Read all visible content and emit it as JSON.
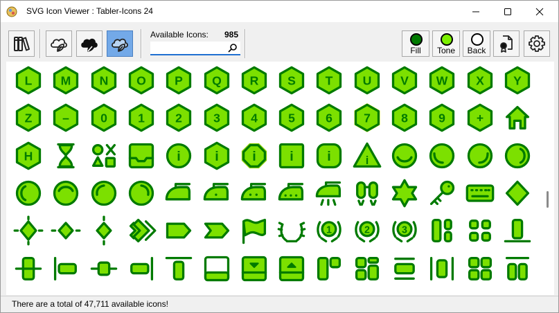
{
  "window": {
    "title": "SVG Icon Viewer : Tabler-Icons 24"
  },
  "toolbar": {
    "available_label": "Available Icons:",
    "available_count": "985",
    "search_value": "",
    "fill_label": "Fill",
    "tone_label": "Tone",
    "back_label": "Back",
    "fill_color": "#007a00",
    "tone_color": "#7cf000",
    "back_color": "#ffffff"
  },
  "colors": {
    "icon_fill": "#7ce000",
    "icon_stroke": "#007a00",
    "active_tab": "#73a9e8"
  },
  "grid": {
    "rows": [
      [
        {
          "shape": "hexagon",
          "label": "L"
        },
        {
          "shape": "hexagon",
          "label": "M"
        },
        {
          "shape": "hexagon",
          "label": "N"
        },
        {
          "shape": "hexagon",
          "label": "O"
        },
        {
          "shape": "hexagon",
          "label": "P"
        },
        {
          "shape": "hexagon",
          "label": "Q"
        },
        {
          "shape": "hexagon",
          "label": "R"
        },
        {
          "shape": "hexagon",
          "label": "S"
        },
        {
          "shape": "hexagon",
          "label": "T"
        },
        {
          "shape": "hexagon",
          "label": "U"
        },
        {
          "shape": "hexagon",
          "label": "V"
        },
        {
          "shape": "hexagon",
          "label": "W"
        },
        {
          "shape": "hexagon",
          "label": "X"
        },
        {
          "shape": "hexagon",
          "label": "Y"
        }
      ],
      [
        {
          "shape": "hexagon",
          "label": "Z"
        },
        {
          "shape": "hexagon",
          "label": "–"
        },
        {
          "shape": "hexagon",
          "label": "0"
        },
        {
          "shape": "hexagon",
          "label": "1"
        },
        {
          "shape": "hexagon",
          "label": "2"
        },
        {
          "shape": "hexagon",
          "label": "3"
        },
        {
          "shape": "hexagon",
          "label": "4"
        },
        {
          "shape": "hexagon",
          "label": "5"
        },
        {
          "shape": "hexagon",
          "label": "6"
        },
        {
          "shape": "hexagon-selected",
          "label": "7"
        },
        {
          "shape": "hexagon",
          "label": "8"
        },
        {
          "shape": "hexagon",
          "label": "9"
        },
        {
          "shape": "hexagon",
          "label": "+"
        },
        {
          "shape": "home",
          "label": ""
        }
      ],
      [
        {
          "shape": "hexagon",
          "label": "H"
        },
        {
          "shape": "hourglass",
          "label": ""
        },
        {
          "shape": "category",
          "label": ""
        },
        {
          "shape": "inbox",
          "label": ""
        },
        {
          "shape": "circle-info",
          "label": "i"
        },
        {
          "shape": "hexagon-info",
          "label": "i"
        },
        {
          "shape": "octagon-info",
          "label": "i"
        },
        {
          "shape": "square-info",
          "label": "i"
        },
        {
          "shape": "rounded-info",
          "label": "i"
        },
        {
          "shape": "triangle-info",
          "label": "i"
        },
        {
          "shape": "circle-arc-bottom",
          "label": ""
        },
        {
          "shape": "circle-arc-left-bottom",
          "label": ""
        },
        {
          "shape": "circle-arc-right-bottom",
          "label": ""
        },
        {
          "shape": "circle-arc-right",
          "label": ""
        }
      ],
      [
        {
          "shape": "circle-arc-left",
          "label": ""
        },
        {
          "shape": "circle-arc-top",
          "label": ""
        },
        {
          "shape": "circle-arc-top-left",
          "label": ""
        },
        {
          "shape": "circle-arc-top-right",
          "label": ""
        },
        {
          "shape": "iron",
          "label": ""
        },
        {
          "shape": "iron-1",
          "label": ""
        },
        {
          "shape": "iron-2",
          "label": ""
        },
        {
          "shape": "iron-3",
          "label": ""
        },
        {
          "shape": "iron-steam",
          "label": ""
        },
        {
          "shape": "jetpack",
          "label": ""
        },
        {
          "shape": "jewish-star",
          "label": ""
        },
        {
          "shape": "key",
          "label": ""
        },
        {
          "shape": "keyboard",
          "label": ""
        },
        {
          "shape": "diamond",
          "label": ""
        }
      ],
      [
        {
          "shape": "diamond-line-both",
          "label": ""
        },
        {
          "shape": "diamond-line-h",
          "label": ""
        },
        {
          "shape": "diamond-line-v",
          "label": ""
        },
        {
          "shape": "chevrons-right",
          "label": ""
        },
        {
          "shape": "label",
          "label": ""
        },
        {
          "shape": "label-important",
          "label": ""
        },
        {
          "shape": "map-flag",
          "label": ""
        },
        {
          "shape": "laurel",
          "label": ""
        },
        {
          "shape": "laurel-1",
          "label": "1"
        },
        {
          "shape": "laurel-2",
          "label": "2"
        },
        {
          "shape": "laurel-3",
          "label": "3"
        },
        {
          "shape": "layout-columns",
          "label": ""
        },
        {
          "shape": "layout-grid",
          "label": ""
        },
        {
          "shape": "align-bottom",
          "label": ""
        }
      ],
      [
        {
          "shape": "align-center-v",
          "label": ""
        },
        {
          "shape": "align-left-h",
          "label": ""
        },
        {
          "shape": "align-center-h",
          "label": ""
        },
        {
          "shape": "align-right-h",
          "label": ""
        },
        {
          "shape": "align-top",
          "label": ""
        },
        {
          "shape": "layout-bottombar",
          "label": ""
        },
        {
          "shape": "layout-bottombar-collapse",
          "label": ""
        },
        {
          "shape": "layout-bottombar-expand",
          "label": ""
        },
        {
          "shape": "layout-cards",
          "label": ""
        },
        {
          "shape": "layout-dashboard",
          "label": ""
        },
        {
          "shape": "align-center-bar",
          "label": ""
        },
        {
          "shape": "distribute-h",
          "label": ""
        },
        {
          "shape": "layout-grid-2",
          "label": ""
        },
        {
          "shape": "distribute-v",
          "label": ""
        }
      ]
    ]
  },
  "status": {
    "text": "There are a total of 47,711 available icons!"
  }
}
